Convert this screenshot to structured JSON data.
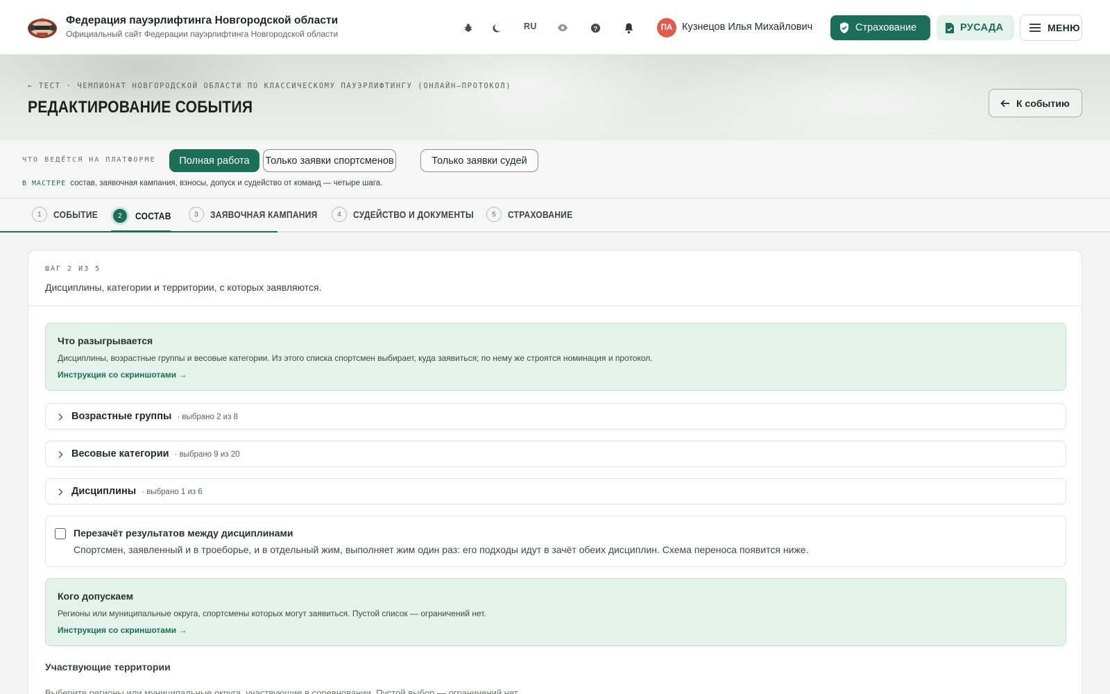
{
  "header": {
    "org_title": "Федерация пауэрлифтинга Новгородской области",
    "org_subtitle": "Официальный сайт Федерации пауэрлифтинга Новгородской области",
    "lang": "RU",
    "user_initials": "ПА",
    "user_name": "Кузнецов Илья Михайлович",
    "insurance_label": "Страхование",
    "rusada_label": "РУСАДА",
    "menu_label": "МЕНЮ",
    "icons": [
      "bug-icon",
      "moon-icon",
      "eye-icon",
      "help-icon",
      "bell-icon"
    ]
  },
  "hero": {
    "breadcrumb": "← ТЕСТ · ЧЕМПИОНАТ НОВГОРОДСКОЙ ОБЛАСТИ ПО КЛАССИЧЕСКОМУ ПАУЭРЛИФТИНГУ (ОНЛАЙН–ПРОТОКОЛ)",
    "title": "РЕДАКТИРОВАНИЕ СОБЫТИЯ",
    "back_label": "К событию"
  },
  "mode": {
    "label": "ЧТО ВЕДЁТСЯ НА ПЛАТФОРМЕ",
    "options": [
      "Полная работа",
      "Только заявки спортсменов",
      "Только заявки судей"
    ],
    "selected": "Полная работа",
    "desc_tag": "В МАСТЕРЕ",
    "desc_text": "состав, заявочная кампания, взносы, допуск и судейство от команд — четыре шага."
  },
  "steps": [
    {
      "num": "1",
      "label": "СОБЫТИЕ"
    },
    {
      "num": "2",
      "label": "СОСТАВ"
    },
    {
      "num": "3",
      "label": "ЗАЯВОЧНАЯ КАМПАНИЯ"
    },
    {
      "num": "4",
      "label": "СУДЕЙСТВО И ДОКУМЕНТЫ"
    },
    {
      "num": "5",
      "label": "СТРАХОВАНИЕ"
    }
  ],
  "active_step": 2,
  "wizard_progress_fraction": 0.25,
  "card": {
    "step_of": "ШАГ 2 ИЗ 5",
    "step_desc": "Дисциплины, категории и территории, с которых заявляются.",
    "info1": {
      "title": "Что разыгрывается",
      "text": "Дисциплины, возрастные группы и весовые категории. Из этого списка спортсмен выбирает, куда заявиться; по нему же строятся номинация и протокол.",
      "link": "Инструкция со скриншотами →"
    },
    "accordions": [
      {
        "title": "Возрастные группы",
        "meta": "· выбрано 2 из 8"
      },
      {
        "title": "Весовые категории",
        "meta": "· выбрано 9 из 20"
      },
      {
        "title": "Дисциплины",
        "meta": "· выбрано 1 из 6"
      }
    ],
    "recount": {
      "title": "Перезачёт результатов между дисциплинами",
      "desc": "Спортсмен, заявленный и в троеборье, и в отдельный жим, выполняет жим один раз: его подходы идут в зачёт обеих дисциплин. Схема переноса появится ниже.",
      "checked": false
    },
    "info2": {
      "title": "Кого допускаем",
      "text": "Регионы или муниципальные округа, спортсмены которых могут заявиться. Пустой список — ограничений нет.",
      "link": "Инструкция со скриншотами →"
    },
    "territories_label": "Участвующие территории",
    "territories_hint": "Выберите регионы или муниципальные округа, участвующие в соревновании. Пустой выбор — ограничений нет."
  },
  "colors": {
    "accent": "#1b6f58",
    "info_bg": "#e3f2eb",
    "avatar": "#e15a4a"
  }
}
